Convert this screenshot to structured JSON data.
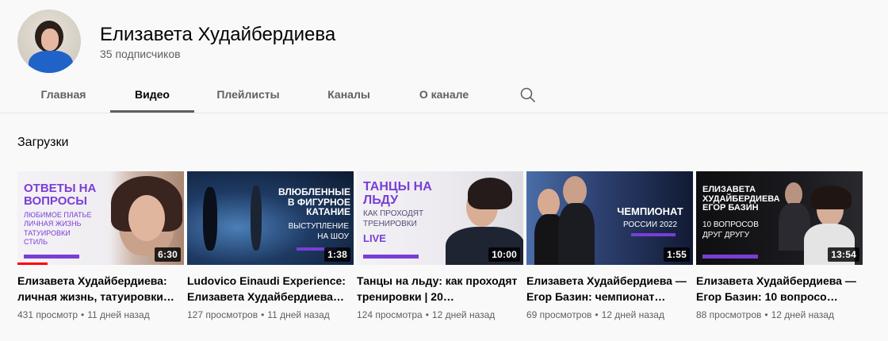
{
  "channel": {
    "name": "Елизавета Худайбердиева",
    "subscribers": "35 подписчиков"
  },
  "tabs": [
    {
      "label": "Главная",
      "active": false
    },
    {
      "label": "Видео",
      "active": true
    },
    {
      "label": "Плейлисты",
      "active": false
    },
    {
      "label": "Каналы",
      "active": false
    },
    {
      "label": "О канале",
      "active": false
    }
  ],
  "search_icon": "search-icon",
  "section": {
    "title": "Загрузки"
  },
  "videos": [
    {
      "title": "Елизавета Худайбердиева: личная жизнь, татуировки…",
      "views": "431 просмотр",
      "age": "11 дней назад",
      "duration": "6:30",
      "thumb_title": "ОТВЕТЫ НА ВОПРОСЫ",
      "thumb_lines": [
        "ЛЮБИМОЕ ПЛАТЬЕ",
        "ЛИЧНАЯ ЖИЗНЬ",
        "ТАТУИРОВКИ",
        "СТИЛЬ"
      ]
    },
    {
      "title": "Ludovico Einaudi Experience: Елизавета Худайбердиева…",
      "views": "127 просмотров",
      "age": "11 дней назад",
      "duration": "1:38",
      "thumb_title": "ВЛЮБЛЕННЫЕ В ФИГУРНОЕ КАТАНИЕ",
      "thumb_lines": [
        "ВЫСТУПЛЕНИЕ",
        "НА ШОУ"
      ]
    },
    {
      "title": "Танцы на льду: как проходят тренировки | 20…",
      "views": "124 просмотра",
      "age": "12 дней назад",
      "duration": "10:00",
      "thumb_title": "ТАНЦЫ НА ЛЬДУ",
      "thumb_lines": [
        "КАК ПРОХОДЯТ",
        "ТРЕНИРОВКИ"
      ],
      "thumb_extra": "LIVE"
    },
    {
      "title": "Елизавета Худайбердиева — Егор Базин: чемпионат…",
      "views": "69 просмотров",
      "age": "12 дней назад",
      "duration": "1:55",
      "thumb_title": "ЧЕМПИОНАТ",
      "thumb_lines": [
        "РОССИИ 2022"
      ]
    },
    {
      "title": "Елизавета Худайбердиева — Егор Базин: 10 вопросо…",
      "views": "88 просмотров",
      "age": "12 дней назад",
      "duration": "13:54",
      "thumb_title": "ЕЛИЗАВЕТА ХУДАЙБЕРДИЕВА ЕГОР БАЗИН",
      "thumb_lines": [
        "10 ВОПРОСОВ",
        "ДРУГ ДРУГУ"
      ]
    }
  ],
  "colors": {
    "accent_purple": "#7a3ed6",
    "progress_red": "#ff0000",
    "text_secondary": "#606060"
  }
}
